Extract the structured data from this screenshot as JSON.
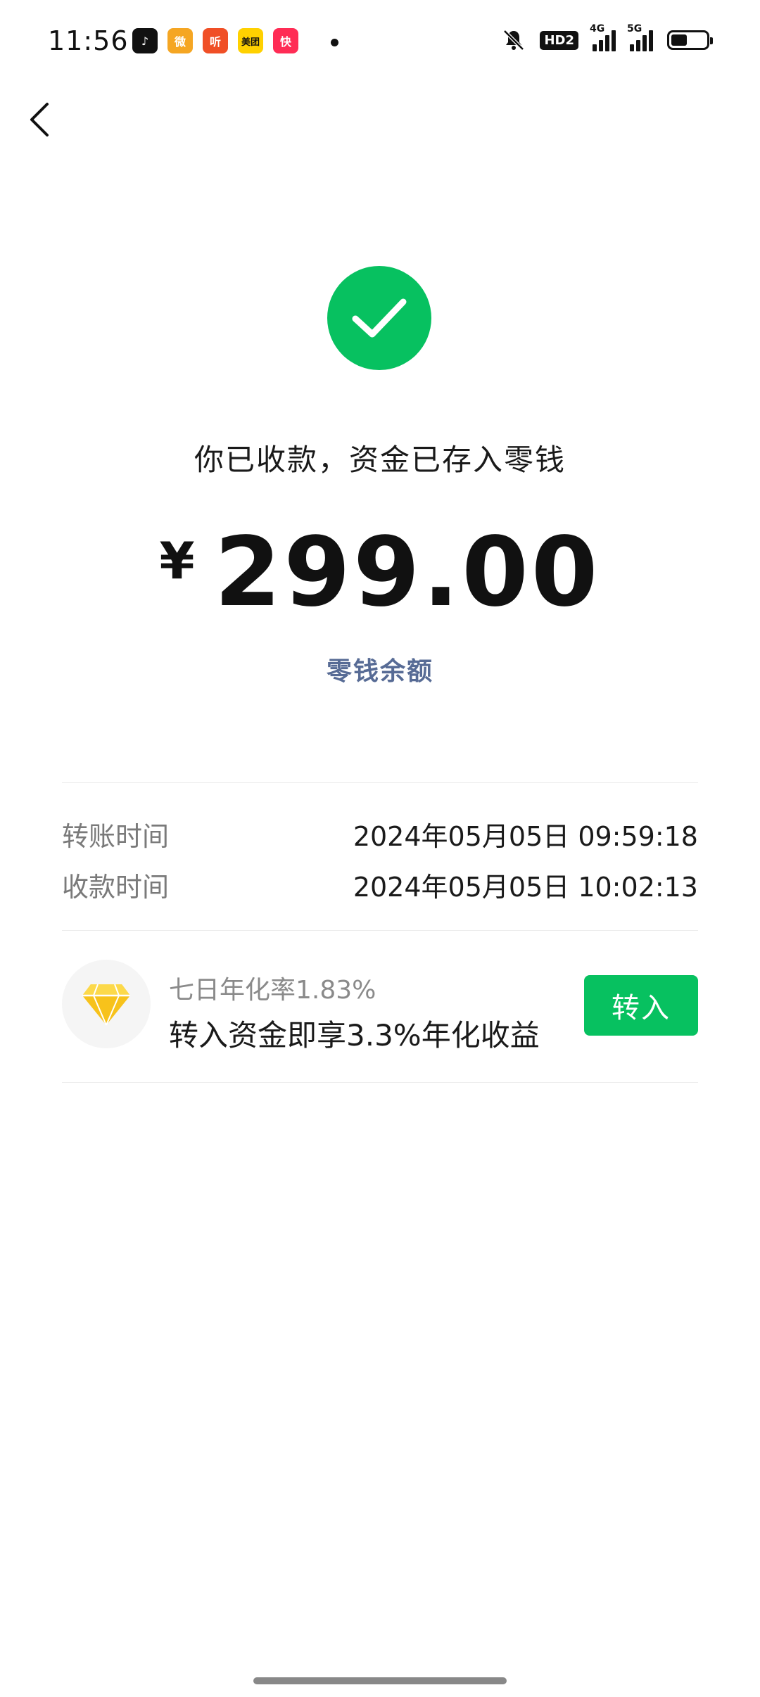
{
  "status_bar": {
    "time": "11:56",
    "notification_apps": [
      {
        "name": "douyin-icon",
        "glyph": "♪",
        "color": "#111111"
      },
      {
        "name": "weibo-icon",
        "glyph": "微",
        "color": "#f5a623"
      },
      {
        "name": "ting-icon",
        "glyph": "听",
        "color": "#f04f26"
      },
      {
        "name": "meituan-icon",
        "glyph": "美团",
        "color": "#ffd100"
      },
      {
        "name": "kuaishou-icon",
        "glyph": "快",
        "color": "#ff2c55"
      }
    ],
    "network_hd": "HD2",
    "network_4g": "4G",
    "network_5g": "5G"
  },
  "result": {
    "message": "你已收款，资金已存入零钱",
    "currency": "¥",
    "amount": "299.00",
    "balance_link": "零钱余额"
  },
  "details": [
    {
      "label": "转账时间",
      "value": "2024年05月05日 09:59:18"
    },
    {
      "label": "收款时间",
      "value": "2024年05月05日 10:02:13"
    }
  ],
  "promo": {
    "icon": "diamond-icon",
    "subtitle": "七日年化率1.83%",
    "title": "转入资金即享3.3%年化收益",
    "button_label": "转入"
  },
  "colors": {
    "accent_green": "#07c160",
    "link_blue": "#576b95",
    "diamond_gold": "#f7c21b"
  }
}
